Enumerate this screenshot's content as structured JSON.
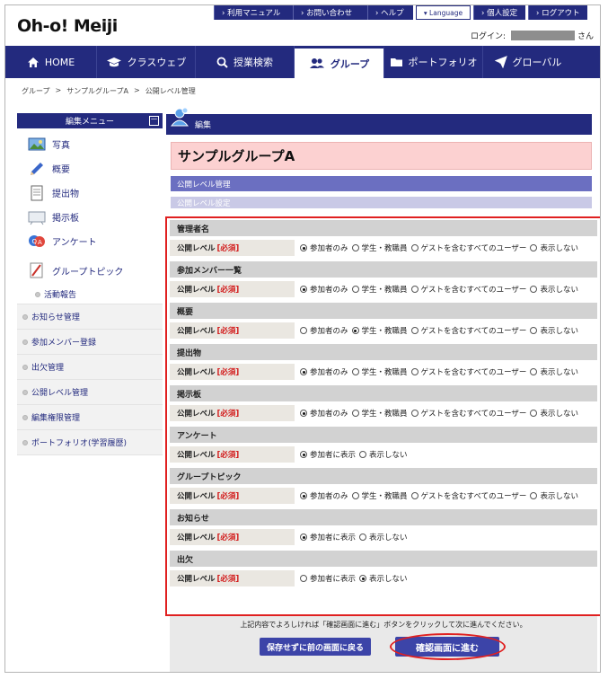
{
  "header": {
    "logo": "Oh-o! Meiji",
    "toplinks": [
      {
        "label": "› 利用マニュアル"
      },
      {
        "label": "› お問い合わせ"
      },
      {
        "label": "› ヘルプ"
      }
    ],
    "language": "▾ Language",
    "settings": "› 個人設定",
    "logout": "› ログアウト",
    "login_label": "ログイン:",
    "login_suffix": "さん"
  },
  "nav": [
    {
      "label": "HOME",
      "icon": "home-icon"
    },
    {
      "label": "クラスウェブ",
      "icon": "graduation-cap-icon"
    },
    {
      "label": "授業検索",
      "icon": "search-icon"
    },
    {
      "label": "グループ",
      "icon": "group-icon",
      "active": true
    },
    {
      "label": "ポートフォリオ",
      "icon": "folder-icon"
    },
    {
      "label": "グローバル",
      "icon": "airplane-icon"
    }
  ],
  "breadcrumb": [
    "グループ",
    ">",
    "サンプルグループA",
    ">",
    "公開レベル管理"
  ],
  "sidebar": {
    "title": "編集メニュー",
    "toggle": "－",
    "items": [
      {
        "label": "写真",
        "icon": "photo-icon"
      },
      {
        "label": "概要",
        "icon": "pencil-icon"
      },
      {
        "label": "提出物",
        "icon": "document-icon"
      },
      {
        "label": "掲示板",
        "icon": "board-icon"
      },
      {
        "label": "アンケート",
        "icon": "qa-icon"
      },
      {
        "label": "グループトピック",
        "icon": "notebook-icon"
      }
    ],
    "activity": "活動報告",
    "subitems": [
      "お知らせ管理",
      "参加メンバー登録",
      "出欠管理",
      "公開レベル管理",
      "編集権限管理",
      "ポートフォリオ(学習履歴)"
    ]
  },
  "main": {
    "edit_label": "編集",
    "group_title": "サンプルグループA",
    "bar1": "公開レベル管理",
    "bar2": "公開レベル設定"
  },
  "level_label": "公開レベル",
  "required_label": "[必須]",
  "sections": [
    {
      "title": "管理者名",
      "options": [
        "参加者のみ",
        "学生・教職員",
        "ゲストを含むすべてのユーザー",
        "表示しない"
      ],
      "selected": 0
    },
    {
      "title": "参加メンバー一覧",
      "options": [
        "参加者のみ",
        "学生・教職員",
        "ゲストを含むすべてのユーザー",
        "表示しない"
      ],
      "selected": 0
    },
    {
      "title": "概要",
      "options": [
        "参加者のみ",
        "学生・教職員",
        "ゲストを含むすべてのユーザー",
        "表示しない"
      ],
      "selected": 1
    },
    {
      "title": "提出物",
      "options": [
        "参加者のみ",
        "学生・教職員",
        "ゲストを含むすべてのユーザー",
        "表示しない"
      ],
      "selected": 0
    },
    {
      "title": "掲示板",
      "options": [
        "参加者のみ",
        "学生・教職員",
        "ゲストを含むすべてのユーザー",
        "表示しない"
      ],
      "selected": 0
    },
    {
      "title": "アンケート",
      "options": [
        "参加者に表示",
        "表示しない"
      ],
      "selected": 0
    },
    {
      "title": "グループトピック",
      "options": [
        "参加者のみ",
        "学生・教職員",
        "ゲストを含むすべてのユーザー",
        "表示しない"
      ],
      "selected": 0
    },
    {
      "title": "お知らせ",
      "options": [
        "参加者に表示",
        "表示しない"
      ],
      "selected": 0
    },
    {
      "title": "出欠",
      "options": [
        "参加者に表示",
        "表示しない"
      ],
      "selected": 1
    }
  ],
  "footer": {
    "note": "上記内容でよろしければ「確認画面に進む」ボタンをクリックして次に進んでください。",
    "back_button": "保存せずに前の画面に戻る",
    "next_button": "確認画面に進む"
  },
  "colors": {
    "navy": "#232a7e",
    "pink": "#fcd1d1",
    "highlight": "#e02020"
  }
}
